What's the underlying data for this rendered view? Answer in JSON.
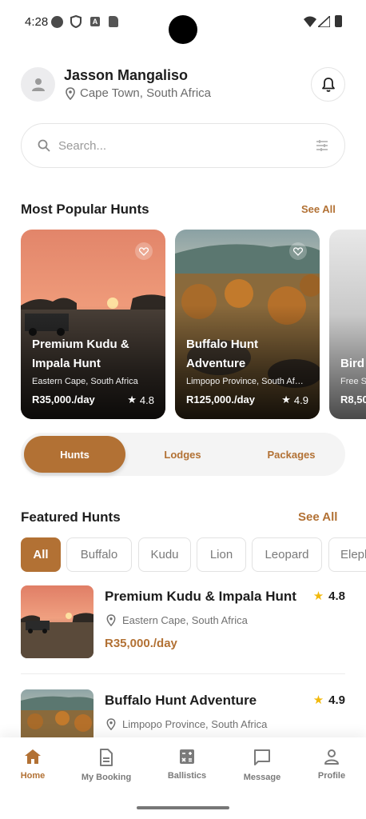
{
  "status_bar": {
    "time": "4:28"
  },
  "header": {
    "user_name": "Jasson Mangaliso",
    "location": "Cape Town, South Africa",
    "icons": [
      "person-icon",
      "location-pin-icon",
      "bell-icon"
    ]
  },
  "search": {
    "placeholder": "Search...",
    "icons": [
      "search-icon",
      "filter-sliders-icon"
    ]
  },
  "popular": {
    "title": "Most Popular Hunts",
    "see_all": "See All",
    "cards": [
      {
        "title": "Premium Kudu & Impala Hunt",
        "location": "Eastern Cape, South Africa",
        "price": "R35,000./day",
        "rating": "4.8"
      },
      {
        "title": "Buffalo Hunt Adventure",
        "location": "Limpopo Province, South Africa",
        "price": "R125,000./day",
        "rating": "4.9"
      },
      {
        "title": "Bird",
        "location": "Free S",
        "price": "R8,50"
      }
    ]
  },
  "segment": {
    "tabs": [
      "Hunts",
      "Lodges",
      "Packages"
    ],
    "active": "Hunts"
  },
  "featured": {
    "title": "Featured Hunts",
    "see_all": "See All",
    "chips": [
      "All",
      "Buffalo",
      "Kudu",
      "Lion",
      "Leopard",
      "Eleph"
    ],
    "items": [
      {
        "title": "Premium Kudu & Impala Hunt",
        "location": "Eastern Cape, South Africa",
        "price": "R35,000./day",
        "rating": "4.8"
      },
      {
        "title": "Buffalo Hunt Adventure",
        "location": "Limpopo Province, South Africa",
        "rating": "4.9"
      }
    ]
  },
  "bottom_nav": {
    "items": [
      {
        "label": "Home",
        "icon": "home-icon"
      },
      {
        "label": "My Booking",
        "icon": "document-icon"
      },
      {
        "label": "Ballistics",
        "icon": "calculator-icon"
      },
      {
        "label": "Message",
        "icon": "chat-icon"
      },
      {
        "label": "Profile",
        "icon": "profile-icon"
      }
    ],
    "active": "Home"
  },
  "colors": {
    "accent": "#b27134",
    "text": "#1d1d1d",
    "muted": "#7a7a7a",
    "star": "#f2b90c"
  }
}
